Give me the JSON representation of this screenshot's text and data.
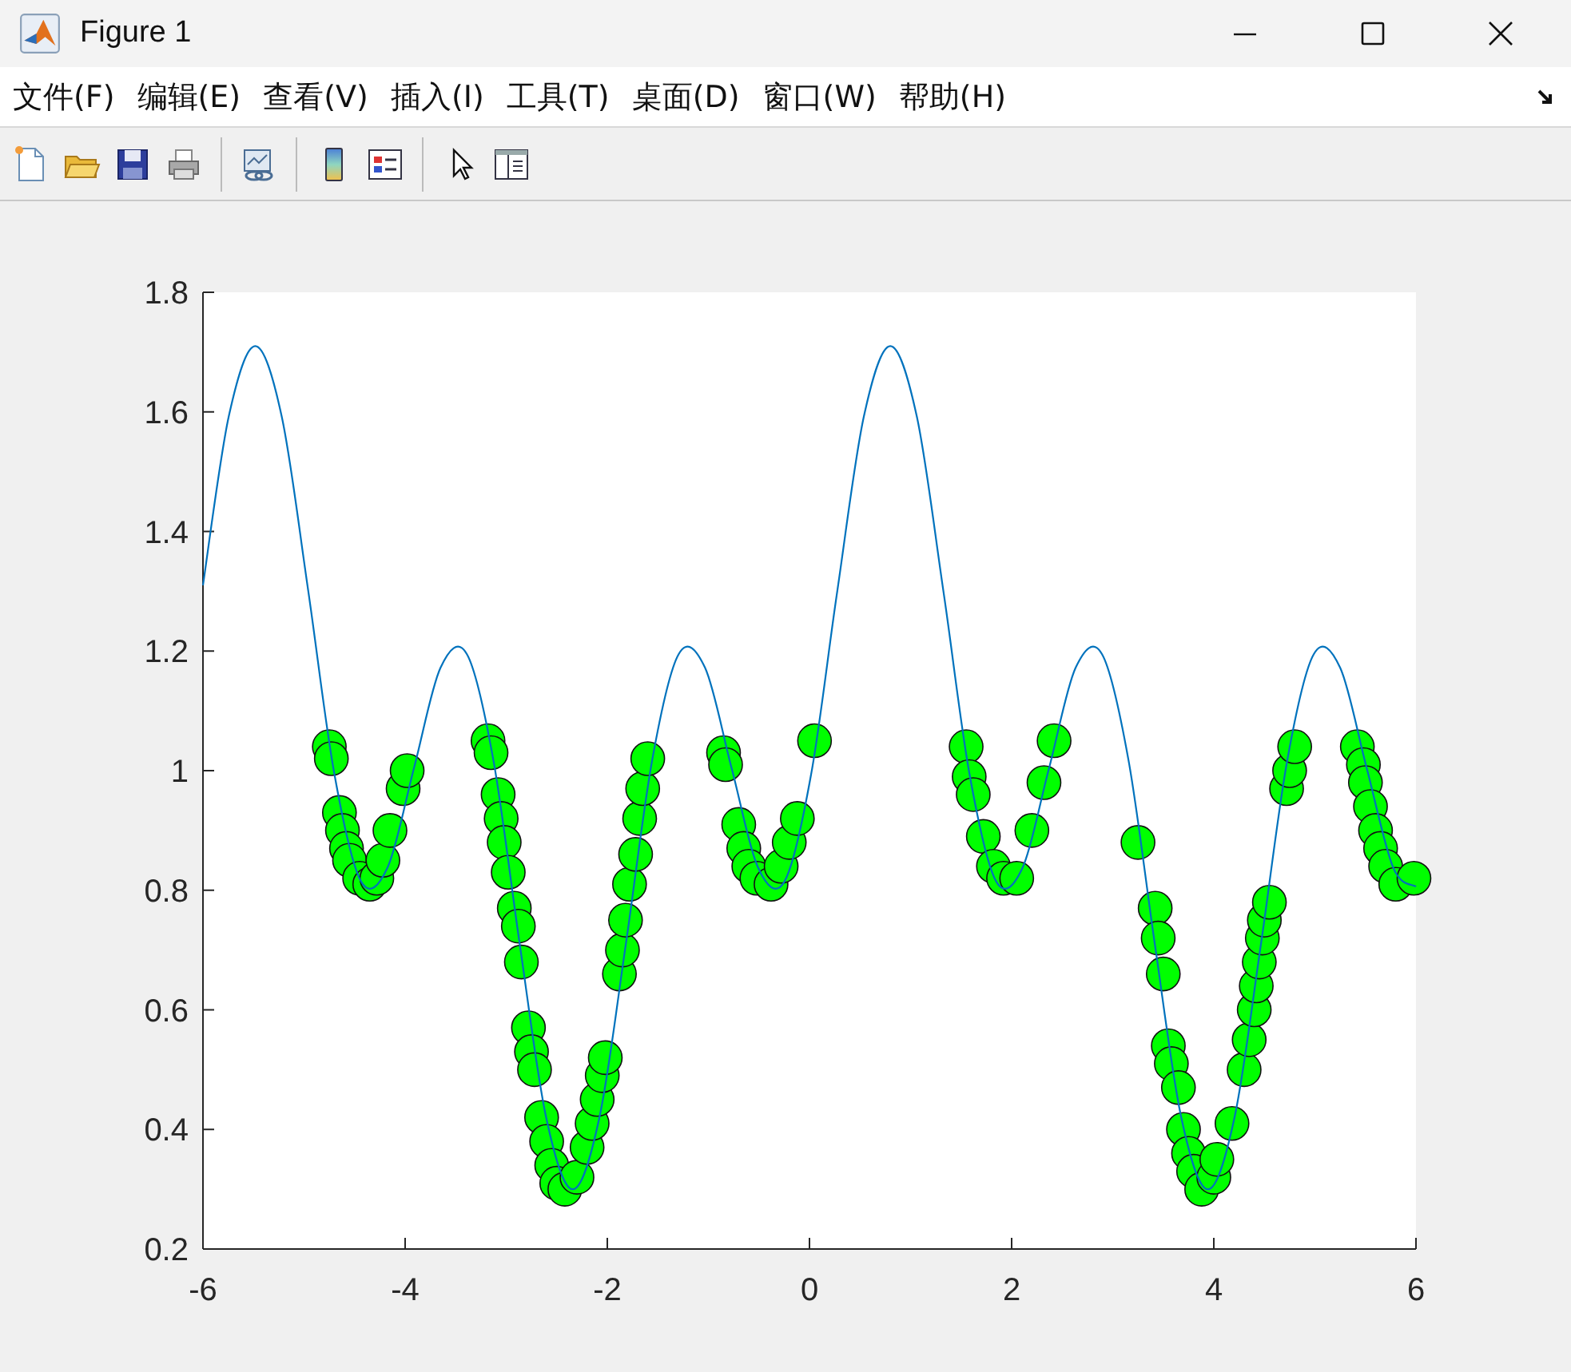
{
  "window": {
    "title": "Figure 1"
  },
  "menu": [
    "文件(F)",
    "编辑(E)",
    "查看(V)",
    "插入(I)",
    "工具(T)",
    "桌面(D)",
    "窗口(W)",
    "帮助(H)"
  ],
  "scatter_plot": {
    "chart_data": {
      "type": "scatter",
      "xlim": [
        -6,
        6
      ],
      "ylim": [
        0.2,
        1.8
      ],
      "xticks": [
        -6,
        -4,
        -2,
        0,
        2,
        4,
        6
      ],
      "yticks": [
        0.2,
        0.4,
        0.6,
        0.8,
        {
          "value": 1,
          "label": "1"
        },
        1.2,
        1.4,
        1.6,
        1.8
      ],
      "x": [
        -4.75,
        -4.73,
        -4.65,
        -4.62,
        -4.58,
        -4.55,
        -4.45,
        -4.35,
        -4.28,
        -4.22,
        -4.15,
        -4.02,
        -3.98,
        -3.18,
        -3.15,
        -3.08,
        -3.05,
        -3.02,
        -2.98,
        -2.92,
        -2.88,
        -2.85,
        -2.78,
        -2.75,
        -2.72,
        -2.65,
        -2.6,
        -2.55,
        -2.5,
        -2.42,
        -2.3,
        -2.2,
        -2.15,
        -2.1,
        -2.05,
        -2.02,
        -1.88,
        -1.85,
        -1.82,
        -1.78,
        -1.72,
        -1.68,
        -1.65,
        -1.6,
        -0.85,
        -0.83,
        -0.7,
        -0.65,
        -0.6,
        -0.52,
        -0.38,
        -0.28,
        -0.2,
        -0.12,
        0.05,
        1.55,
        1.58,
        1.62,
        1.72,
        1.82,
        1.92,
        2.05,
        2.2,
        2.32,
        2.42,
        3.25,
        3.42,
        3.45,
        3.5,
        3.55,
        3.58,
        3.65,
        3.7,
        3.75,
        3.8,
        3.88,
        4.0,
        4.03,
        4.18,
        4.3,
        4.35,
        4.4,
        4.42,
        4.45,
        4.48,
        4.5,
        4.55,
        4.72,
        4.75,
        4.8,
        5.42,
        5.48,
        5.5,
        5.55,
        5.6,
        5.65,
        5.7,
        5.8,
        5.98
      ],
      "series": [
        {
          "color": "#00ff00",
          "values": [
            1.04,
            1.02,
            0.93,
            0.9,
            0.87,
            0.85,
            0.82,
            0.81,
            0.82,
            0.85,
            0.9,
            0.97,
            1.0,
            1.05,
            1.03,
            0.96,
            0.92,
            0.88,
            0.83,
            0.77,
            0.74,
            0.68,
            0.57,
            0.53,
            0.5,
            0.42,
            0.38,
            0.34,
            0.31,
            0.3,
            0.32,
            0.37,
            0.41,
            0.45,
            0.49,
            0.52,
            0.66,
            0.7,
            0.75,
            0.81,
            0.86,
            0.92,
            0.97,
            1.02,
            1.03,
            1.01,
            0.91,
            0.87,
            0.84,
            0.82,
            0.81,
            0.84,
            0.88,
            0.92,
            1.05,
            1.04,
            0.99,
            0.96,
            0.89,
            0.84,
            0.82,
            0.82,
            0.9,
            0.98,
            1.05,
            0.88,
            0.77,
            0.72,
            0.66,
            0.54,
            0.51,
            0.47,
            0.4,
            0.36,
            0.33,
            0.3,
            0.32,
            0.35,
            0.41,
            0.5,
            0.55,
            0.6,
            0.64,
            0.68,
            0.72,
            0.75,
            0.78,
            0.97,
            1.0,
            1.04,
            1.04,
            1.01,
            0.98,
            0.94,
            0.9,
            0.87,
            0.84,
            0.81,
            0.82
          ]
        }
      ]
    }
  },
  "line_plot": {
    "chart_data": {
      "type": "line",
      "xlim": [
        -6,
        6
      ],
      "ylim": [
        0.2,
        1.8
      ],
      "x": [
        -6,
        -5.745,
        -5.483,
        -5.221,
        -4.96,
        -4.698,
        -4.436,
        -4.174,
        -3.912,
        -3.651,
        -3.389,
        -3.127,
        -2.865,
        -2.603,
        -2.342,
        -2.08,
        -1.818,
        -1.556,
        -1.294,
        -1.033,
        -0.771,
        -0.509,
        -0.247,
        0.015,
        0.276,
        0.538,
        0.8,
        1.062,
        1.324,
        1.585,
        1.847,
        2.109,
        2.371,
        2.633,
        2.894,
        3.156,
        3.418,
        3.68,
        3.942,
        4.203,
        4.465,
        4.727,
        4.989,
        5.251,
        5.512,
        5.774,
        6
      ],
      "series": [
        {
          "color": "#0072bd",
          "values": [
            1.31,
            1.592,
            1.71,
            1.592,
            1.302,
            0.992,
            0.815,
            0.838,
            1.005,
            1.172,
            1.195,
            1.018,
            0.708,
            0.418,
            0.3,
            0.418,
            0.708,
            1.018,
            1.195,
            1.172,
            1.005,
            0.838,
            0.815,
            0.992,
            1.302,
            1.592,
            1.71,
            1.592,
            1.302,
            0.992,
            0.815,
            0.838,
            1.005,
            1.172,
            1.195,
            1.018,
            0.708,
            0.418,
            0.3,
            0.418,
            0.708,
            1.018,
            1.195,
            1.172,
            1.005,
            0.838,
            0.806
          ]
        }
      ]
    }
  }
}
